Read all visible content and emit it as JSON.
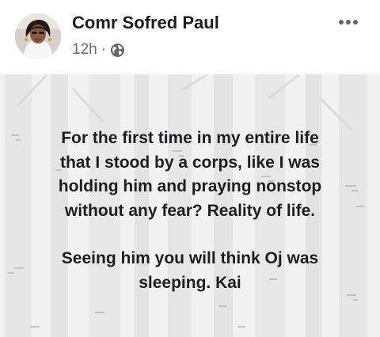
{
  "post": {
    "author_name": "Comr Sofred Paul",
    "timestamp": "12h",
    "separator": "·",
    "privacy_icon": "globe-icon",
    "more_icon": "more-options-icon",
    "background_icon": "birch-forest-background",
    "body_paragraphs": [
      [
        "For the first time in my entire life",
        "that I stood by a corps, like I was",
        "holding him and praying nonstop",
        "without any fear?  Reality of life."
      ],
      [
        "Seeing him you will think Oj was",
        "sleeping. Kai"
      ]
    ]
  },
  "colors": {
    "name_text": "#1c1e21",
    "meta_text": "#65676b",
    "backdrop": "#f1f1f1",
    "trunk": "#e3e3e3",
    "bark_mark": "#c2c2c2"
  }
}
